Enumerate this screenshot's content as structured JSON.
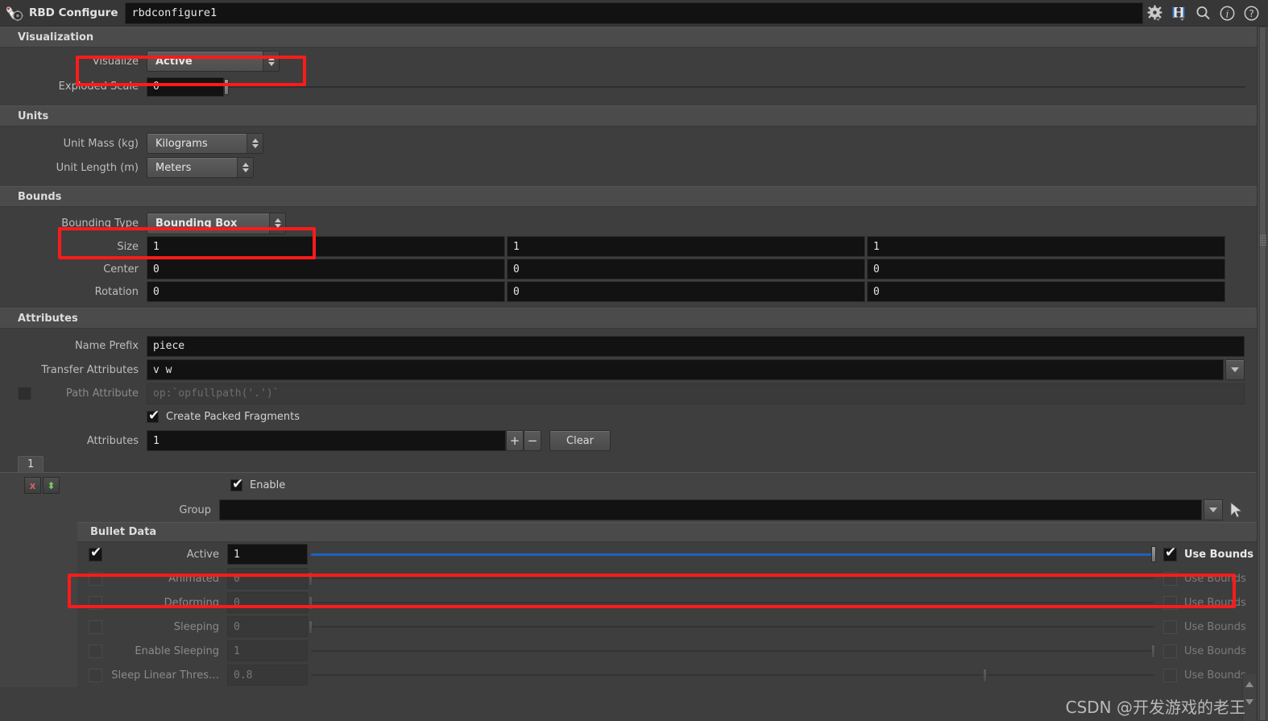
{
  "titlebar": {
    "node_type_label": "RBD Configure",
    "node_name": "rbdconfigure1",
    "icons": [
      "gear-icon",
      "houdini-h-icon",
      "search-icon",
      "info-icon",
      "help-icon"
    ]
  },
  "sections": {
    "visualization": "Visualization",
    "units": "Units",
    "bounds": "Bounds",
    "attributes": "Attributes",
    "bullet_data": "Bullet Data"
  },
  "visualization": {
    "visualize_label": "Visualize",
    "visualize_value": "Active",
    "exploded_scale_label": "Exploded Scale",
    "exploded_scale_value": "0"
  },
  "units": {
    "unit_mass_label": "Unit Mass (kg)",
    "unit_mass_value": "Kilograms",
    "unit_length_label": "Unit Length (m)",
    "unit_length_value": "Meters"
  },
  "bounds": {
    "bounding_type_label": "Bounding Type",
    "bounding_type_value": "Bounding Box",
    "rows": [
      {
        "label": "Size",
        "values": [
          "1",
          "1",
          "1"
        ]
      },
      {
        "label": "Center",
        "values": [
          "0",
          "0",
          "0"
        ]
      },
      {
        "label": "Rotation",
        "values": [
          "0",
          "0",
          "0"
        ]
      }
    ]
  },
  "attributes": {
    "name_prefix_label": "Name Prefix",
    "name_prefix_value": "piece",
    "transfer_attributes_label": "Transfer Attributes",
    "transfer_attributes_value": "v w",
    "path_attribute_label": "Path Attribute",
    "path_attribute_value": "op:`opfullpath('.')`",
    "path_attribute_checked": false,
    "create_packed_label": "Create Packed Fragments",
    "create_packed_checked": true,
    "attributes_count_label": "Attributes",
    "attributes_count_value": "1",
    "add_button": "+",
    "remove_button": "−",
    "clear_button": "Clear"
  },
  "multiparm": {
    "tab_label": "1",
    "delete_button": "x",
    "move_button": "⬍",
    "enable_label": "Enable",
    "enable_checked": true,
    "group_label": "Group",
    "group_value": ""
  },
  "bullet_data": {
    "use_bounds_label": "Use Bounds",
    "rows": [
      {
        "label": "Active",
        "value": "1",
        "checked": true,
        "enabled": true,
        "slider_fill_pct": 100,
        "use_bounds": true
      },
      {
        "label": "Animated",
        "value": "0",
        "checked": false,
        "enabled": false,
        "slider_fill_pct": 0,
        "use_bounds": false
      },
      {
        "label": "Deforming",
        "value": "0",
        "checked": false,
        "enabled": false,
        "slider_fill_pct": 0,
        "use_bounds": false
      },
      {
        "label": "Sleeping",
        "value": "0",
        "checked": false,
        "enabled": false,
        "slider_fill_pct": 0,
        "use_bounds": false
      },
      {
        "label": "Enable Sleeping",
        "value": "1",
        "checked": false,
        "enabled": false,
        "slider_fill_pct": 100,
        "use_bounds": false
      },
      {
        "label": "Sleep Linear Thres…",
        "value": "0.8",
        "checked": false,
        "enabled": false,
        "slider_fill_pct": 80,
        "use_bounds": false
      }
    ]
  },
  "watermark": "CSDN @开发游戏的老王"
}
